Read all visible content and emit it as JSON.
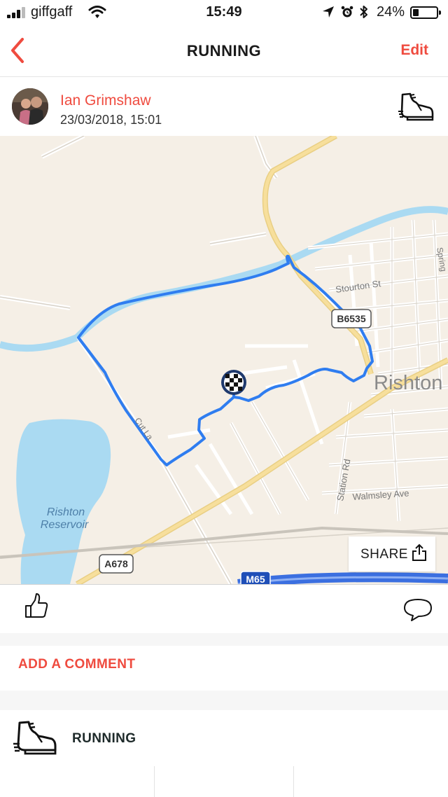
{
  "status_bar": {
    "carrier": "giffgaff",
    "time": "15:49",
    "battery_percent": "24%",
    "battery_level": 0.24,
    "icons": [
      "signal-icon",
      "wifi-icon",
      "location-arrow-icon",
      "alarm-icon",
      "bluetooth-icon",
      "battery-icon"
    ]
  },
  "header": {
    "back_icon": "chevron-left-icon",
    "title": "RUNNING",
    "edit_label": "Edit"
  },
  "activity": {
    "user_name": "Ian Grimshaw",
    "date_time": "23/03/2018, 15:01",
    "type_icon": "running-shoe-icon"
  },
  "map": {
    "labels": {
      "town": "Rishton",
      "reservoir_line1": "Rishton",
      "reservoir_line2": "Reservoir",
      "stourton_st": "Stourton St",
      "walmsley_ave": "Walmsley Ave",
      "station_rd": "Station Rd",
      "spring": "Spring",
      "cut_la": "Cut La"
    },
    "road_shields": {
      "b6535": "B6535",
      "a678": "A678",
      "m65": "M65"
    },
    "finish_icon": "checkered-flag-icon",
    "share_label": "SHARE",
    "share_icon": "share-icon"
  },
  "actions": {
    "like_icon": "thumbs-up-icon",
    "comment_icon": "speech-bubble-icon",
    "add_comment_label": "ADD A COMMENT"
  },
  "activity_type": {
    "icon": "running-shoe-icon",
    "label": "RUNNING"
  },
  "colors": {
    "accent": "#ef4b3f",
    "route": "#2f7df0",
    "water": "#aadaf2",
    "map_bg": "#f5efe6",
    "major_road": "#f7df9c"
  }
}
